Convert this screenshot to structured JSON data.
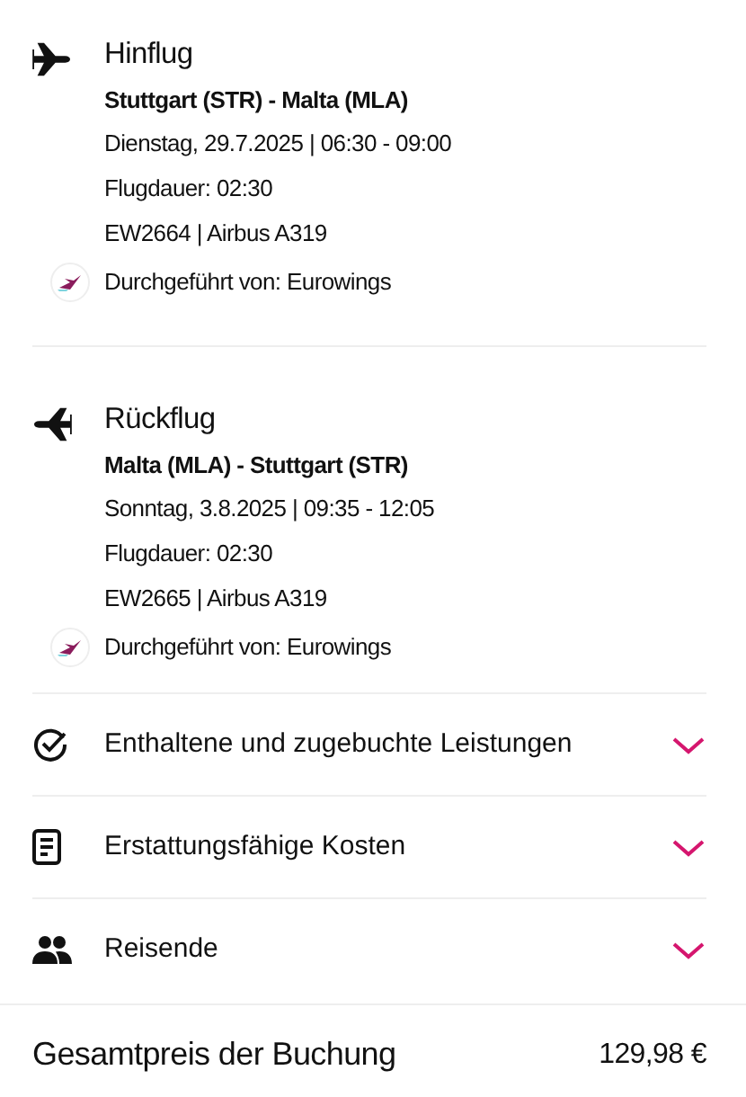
{
  "flights": [
    {
      "kind": "outbound",
      "title": "Hinflug",
      "route": "Stuttgart (STR) - Malta (MLA)",
      "date": "Dienstag, 29.7.2025 | 06:30 - 09:00",
      "duration": "Flugdauer: 02:30",
      "flight": "EW2664 | Airbus A319",
      "operator": "Durchgeführt von: Eurowings"
    },
    {
      "kind": "return",
      "title": "Rückflug",
      "route": "Malta (MLA) - Stuttgart (STR)",
      "date": "Sonntag, 3.8.2025 | 09:35 - 12:05",
      "duration": "Flugdauer: 02:30",
      "flight": "EW2665 | Airbus A319",
      "operator": "Durchgeführt von: Eurowings"
    }
  ],
  "sections": [
    {
      "kind": "services",
      "label": "Enthaltene und zugebuchte Leistungen",
      "expanded": false
    },
    {
      "kind": "costs",
      "label": "Erstattungsfähige Kosten",
      "expanded": false
    },
    {
      "kind": "travellers",
      "label": "Reisende",
      "expanded": false
    }
  ],
  "total": {
    "label": "Gesamtpreis der Buchung",
    "value": "129,98 €"
  }
}
